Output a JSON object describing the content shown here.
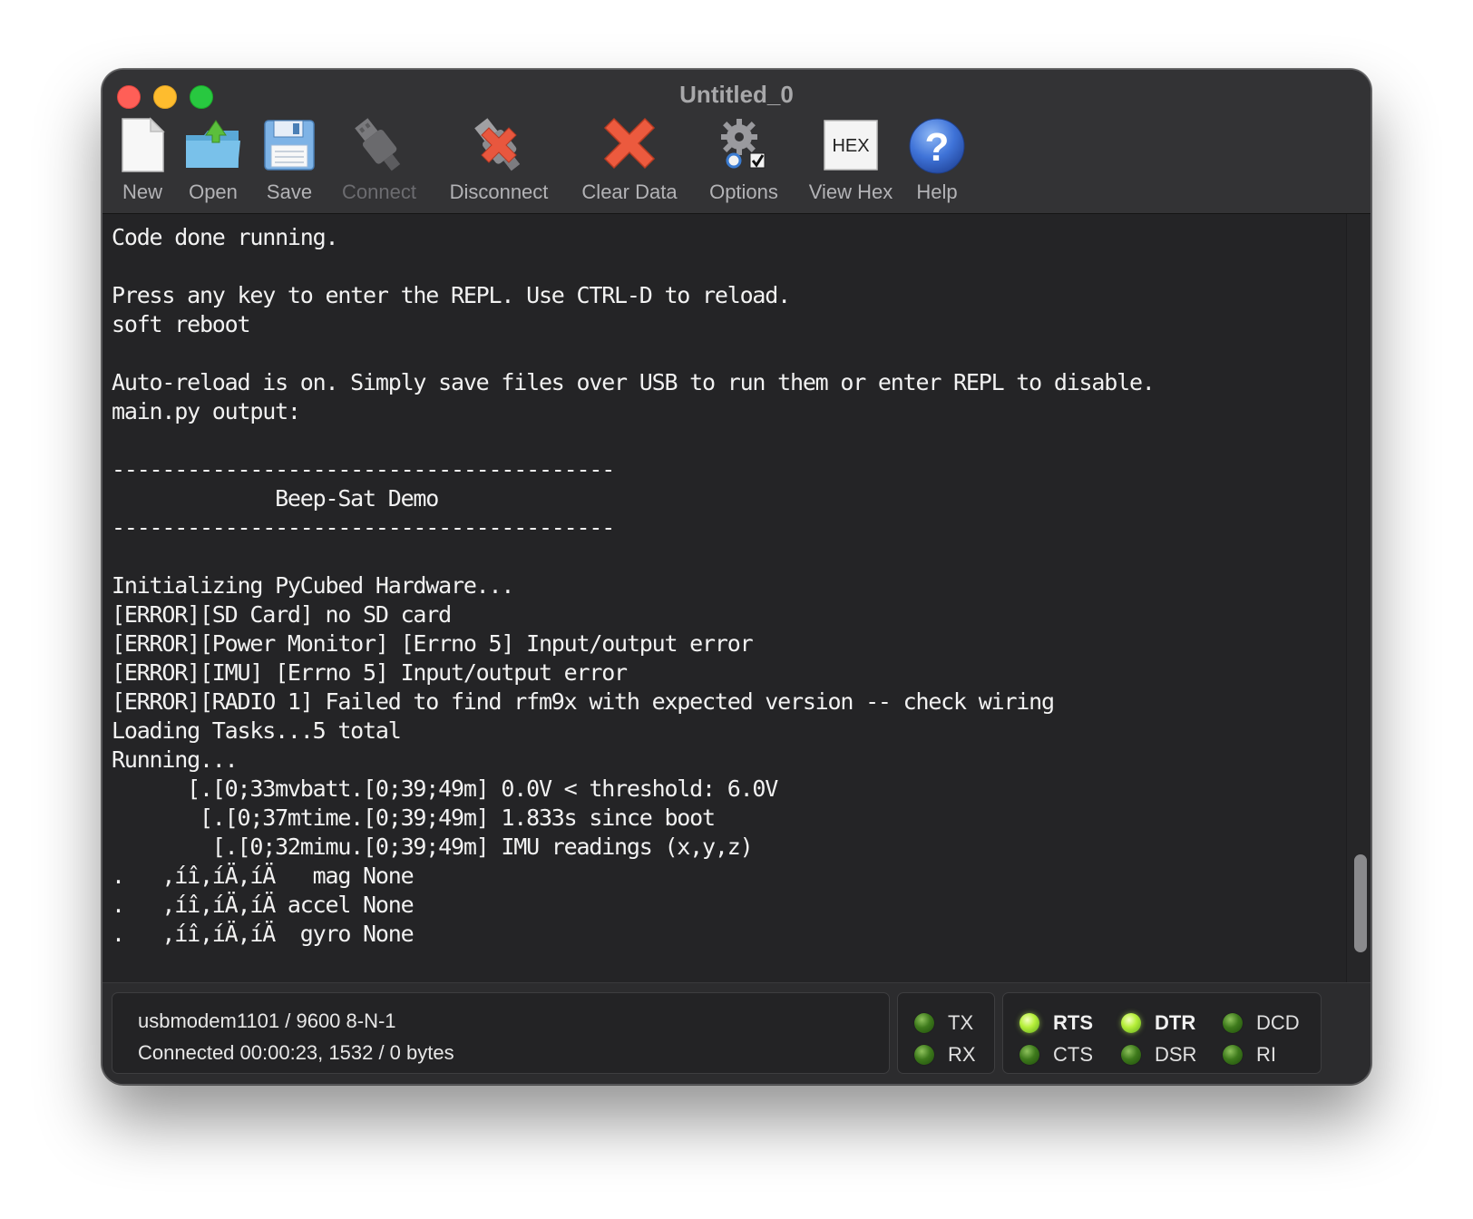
{
  "window": {
    "title": "Untitled_0"
  },
  "toolbar": {
    "items": [
      {
        "label": "New",
        "icon": "new-document-icon",
        "enabled": true
      },
      {
        "label": "Open",
        "icon": "open-folder-icon",
        "enabled": true
      },
      {
        "label": "Save",
        "icon": "floppy-disk-icon",
        "enabled": true
      },
      {
        "label": "Connect",
        "icon": "usb-plug-icon",
        "enabled": false
      },
      {
        "label": "Disconnect",
        "icon": "disconnect-plug-icon",
        "enabled": true
      },
      {
        "label": "Clear Data",
        "icon": "clear-x-icon",
        "enabled": true
      },
      {
        "label": "Options",
        "icon": "gear-options-icon",
        "enabled": true
      },
      {
        "label": "View Hex",
        "icon": "hex-icon",
        "enabled": true,
        "icon_text": "HEX"
      },
      {
        "label": "Help",
        "icon": "help-question-icon",
        "enabled": true,
        "icon_text": "?"
      }
    ]
  },
  "terminal": {
    "lines": [
      "Code done running.",
      "",
      "Press any key to enter the REPL. Use CTRL-D to reload.",
      "soft reboot",
      "",
      "Auto-reload is on. Simply save files over USB to run them or enter REPL to disable.",
      "main.py output:",
      "",
      "----------------------------------------",
      "             Beep-Sat Demo",
      "----------------------------------------",
      "",
      "Initializing PyCubed Hardware...",
      "[ERROR][SD Card] no SD card",
      "[ERROR][Power Monitor] [Errno 5] Input/output error",
      "[ERROR][IMU] [Errno 5] Input/output error",
      "[ERROR][RADIO 1] Failed to find rfm9x with expected version -- check wiring",
      "Loading Tasks...5 total",
      "Running...",
      "      [.[0;33mvbatt.[0;39;49m] 0.0V < threshold: 6.0V",
      "       [.[0;37mtime.[0;39;49m] 1.833s since boot",
      "        [.[0;32mimu.[0;39;49m] IMU readings (x,y,z)",
      ".   ,íî,íÄ,íÄ   mag None",
      ".   ,íî,íÄ,íÄ accel None",
      ".   ,íî,íÄ,íÄ  gyro None"
    ]
  },
  "status": {
    "port": "usbmodem1101 / 9600 8-N-1",
    "connection": "Connected 00:00:23, 1532 / 0 bytes"
  },
  "signals": {
    "tx": {
      "label": "TX",
      "on": false
    },
    "rx": {
      "label": "RX",
      "on": false
    },
    "rts": {
      "label": "RTS",
      "on": true
    },
    "cts": {
      "label": "CTS",
      "on": false
    },
    "dtr": {
      "label": "DTR",
      "on": true
    },
    "dsr": {
      "label": "DSR",
      "on": false
    },
    "dcd": {
      "label": "DCD",
      "on": false
    },
    "ri": {
      "label": "RI",
      "on": false
    }
  },
  "colors": {
    "terminal_bg": "#242426",
    "terminal_text": "#f2f2f2",
    "led_on": "#b6ef3a",
    "led_off": "#3e7a1c"
  }
}
